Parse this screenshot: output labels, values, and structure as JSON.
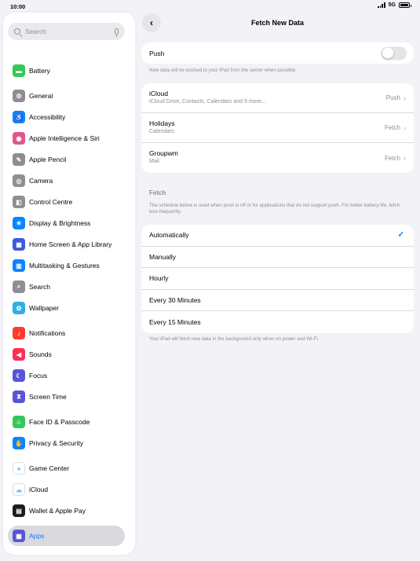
{
  "status_bar": {
    "time": "10:00",
    "network": "5G"
  },
  "sidebar": {
    "search_placeholder": "Search",
    "items": [
      {
        "label": "Battery",
        "icon": "battery-icon",
        "color": "#34c759",
        "glyph": "▬"
      },
      {
        "label": "General",
        "icon": "gear-icon",
        "color": "#8e8e93",
        "glyph": "⚙"
      },
      {
        "label": "Accessibility",
        "icon": "accessibility-icon",
        "color": "#0a84ff",
        "glyph": "♿"
      },
      {
        "label": "Apple Intelligence & Siri",
        "icon": "siri-icon",
        "color": "#e0578c",
        "glyph": "◉"
      },
      {
        "label": "Apple Pencil",
        "icon": "pencil-icon",
        "color": "#8e8e93",
        "glyph": "✎"
      },
      {
        "label": "Camera",
        "icon": "camera-icon",
        "color": "#8e8e93",
        "glyph": "◎"
      },
      {
        "label": "Control Centre",
        "icon": "control-centre-icon",
        "color": "#8e8e93",
        "glyph": "◧"
      },
      {
        "label": "Display & Brightness",
        "icon": "brightness-icon",
        "color": "#0a84ff",
        "glyph": "☀"
      },
      {
        "label": "Home Screen & App Library",
        "icon": "home-screen-icon",
        "color": "#3a5bdc",
        "glyph": "▦"
      },
      {
        "label": "Multitasking & Gestures",
        "icon": "multitasking-icon",
        "color": "#0a84ff",
        "glyph": "▥"
      },
      {
        "label": "Search",
        "icon": "search-icon",
        "color": "#8e8e93",
        "glyph": "⌕"
      },
      {
        "label": "Wallpaper",
        "icon": "wallpaper-icon",
        "color": "#32ade6",
        "glyph": "✿"
      },
      {
        "label": "Notifications",
        "icon": "bell-icon",
        "color": "#ff3b30",
        "glyph": "♪"
      },
      {
        "label": "Sounds",
        "icon": "speaker-icon",
        "color": "#ff2d55",
        "glyph": "◀"
      },
      {
        "label": "Focus",
        "icon": "moon-icon",
        "color": "#5856d6",
        "glyph": "☾"
      },
      {
        "label": "Screen Time",
        "icon": "hourglass-icon",
        "color": "#5856d6",
        "glyph": "⧗"
      },
      {
        "label": "Face ID & Passcode",
        "icon": "face-id-icon",
        "color": "#34c759",
        "glyph": "☺"
      },
      {
        "label": "Privacy & Security",
        "icon": "hand-icon",
        "color": "#0a84ff",
        "glyph": "✋"
      },
      {
        "label": "Game Center",
        "icon": "game-center-icon",
        "color": "#ffffff",
        "glyph": "●"
      },
      {
        "label": "iCloud",
        "icon": "cloud-icon",
        "color": "#ffffff",
        "glyph": "☁"
      },
      {
        "label": "Wallet & Apple Pay",
        "icon": "wallet-icon",
        "color": "#1c1c1e",
        "glyph": "▤"
      },
      {
        "label": "Apps",
        "icon": "apps-icon",
        "color": "#5856d6",
        "glyph": "▦"
      }
    ]
  },
  "header": {
    "title": "Fetch New Data",
    "back_glyph": "‹"
  },
  "push": {
    "label": "Push",
    "enabled": false,
    "note": "New data will be pushed to your iPad from the server when possible."
  },
  "accounts": [
    {
      "name": "iCloud",
      "detail": "iCloud Drive, Contacts, Calendars and 9 more...",
      "value": "Push"
    },
    {
      "name": "Holidays",
      "detail": "Calendars",
      "value": "Fetch"
    },
    {
      "name": "Groupwm",
      "detail": "Mail",
      "value": "Fetch"
    }
  ],
  "fetch": {
    "header": "Fetch",
    "description": "The schedule below is used when push is off or for applications that do not support push. For better battery life, fetch less frequently.",
    "options": [
      "Automatically",
      "Manually",
      "Hourly",
      "Every 30 Minutes",
      "Every 15 Minutes"
    ],
    "selected": "Automatically",
    "footer": "Your iPad will fetch new data in the background only when on power and Wi-Fi."
  },
  "colors": {
    "accent": "#0a7aff",
    "background": "#f2f2f7"
  }
}
